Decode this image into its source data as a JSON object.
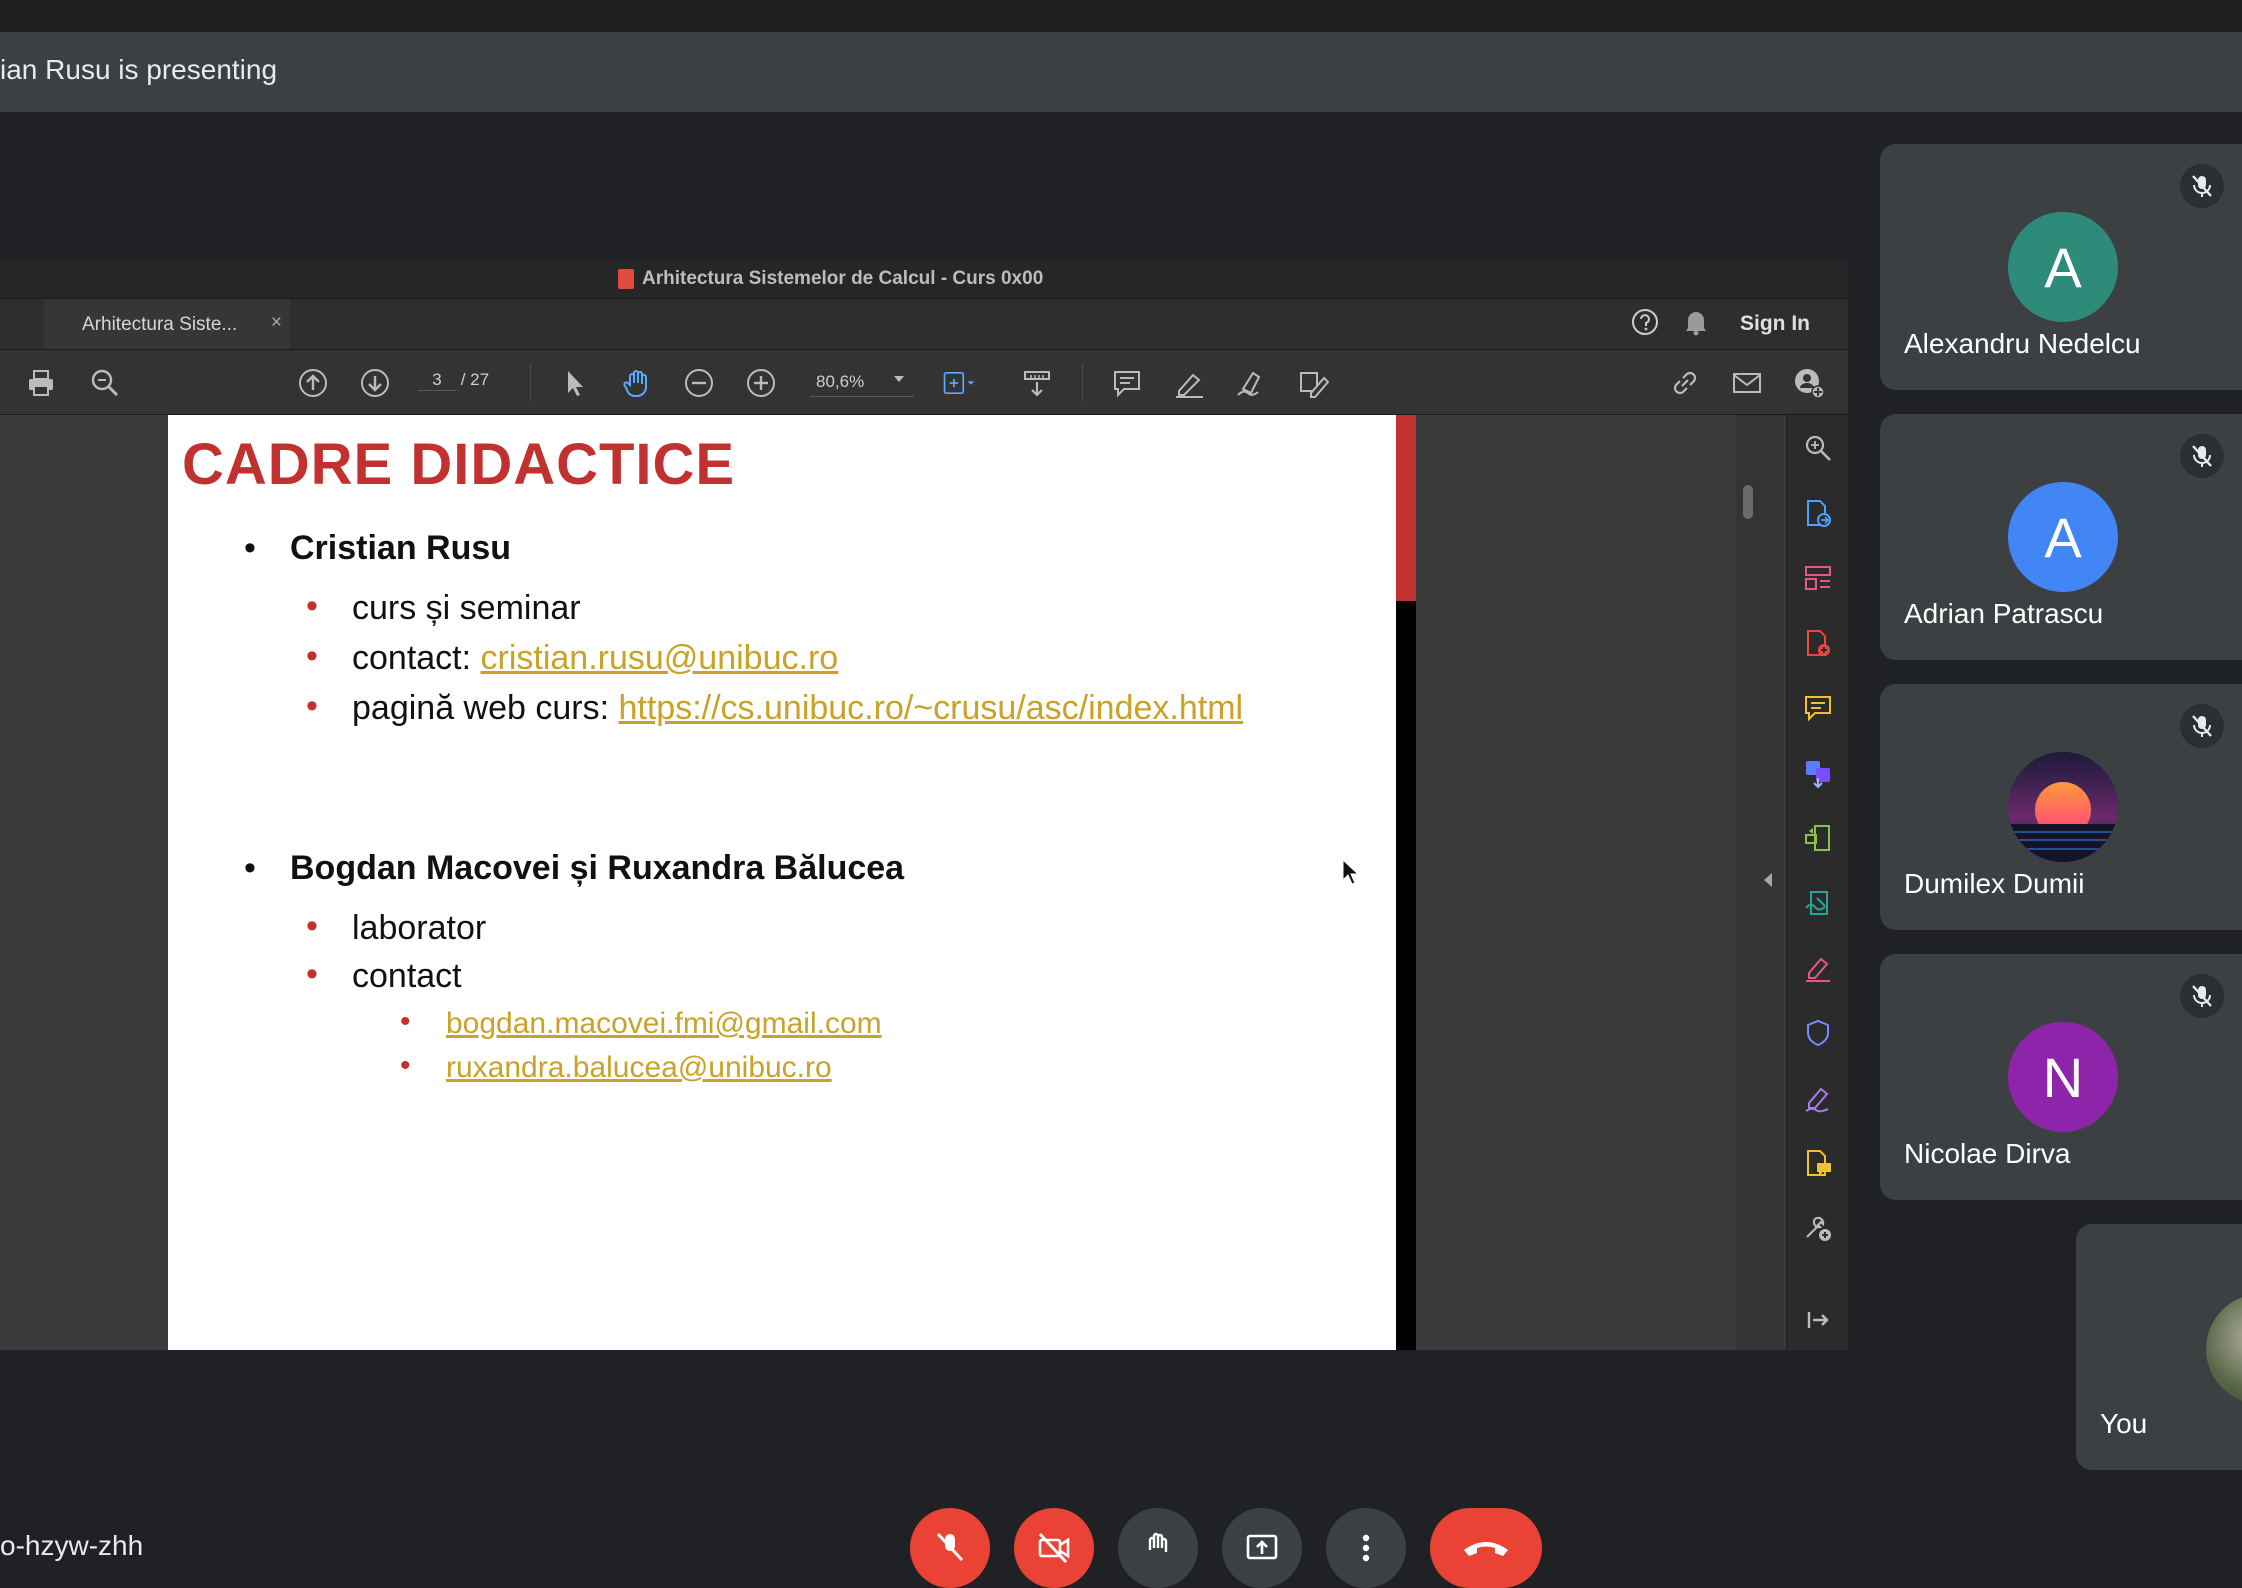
{
  "banner": {
    "presenter_text": "ian Rusu is presenting"
  },
  "acrobat": {
    "window_title": "Arhitectura Sistemelor de Calcul - Curs 0x00",
    "tab_label": "Arhitectura Siste...",
    "tab_close": "×",
    "sign_in": "Sign In",
    "page_current": "3",
    "page_total": "/ 27",
    "zoom": "80,6%"
  },
  "slide": {
    "title": "CADRE DIDACTICE",
    "bullet_glyph": "•",
    "person1": {
      "name": "Cristian Rusu",
      "item1": "curs și seminar",
      "item2_prefix": "contact: ",
      "item2_link": "cristian.rusu@unibuc.ro",
      "item3_prefix": "pagină web curs: ",
      "item3_link": "https://cs.unibuc.ro/~crusu/asc/index.html"
    },
    "person2": {
      "name": "Bogdan Macovei și Ruxandra Bălucea",
      "item1": "laborator",
      "item2": "contact",
      "email1": "bogdan.macovei.fmi@gmail.com",
      "email2": "ruxandra.balucea@unibuc.ro"
    }
  },
  "participants": [
    {
      "name": "Alexandru Nedelcu",
      "initial": "A",
      "color": "#2e8b7a"
    },
    {
      "name": "Adrian Patrascu",
      "initial": "A",
      "color": "#4285f4"
    },
    {
      "name": "Dumilex Dumii",
      "initial": "",
      "color": "#1b1a3a"
    },
    {
      "name": "Nicolae Dirva",
      "initial": "N",
      "color": "#8e24aa"
    }
  ],
  "self_tile": {
    "name": "You"
  },
  "meeting": {
    "code": "o-hzyw-zhh"
  },
  "colors": {
    "accent_red": "#ea4335",
    "slide_red": "#c0312f",
    "link": "#c9a227"
  }
}
